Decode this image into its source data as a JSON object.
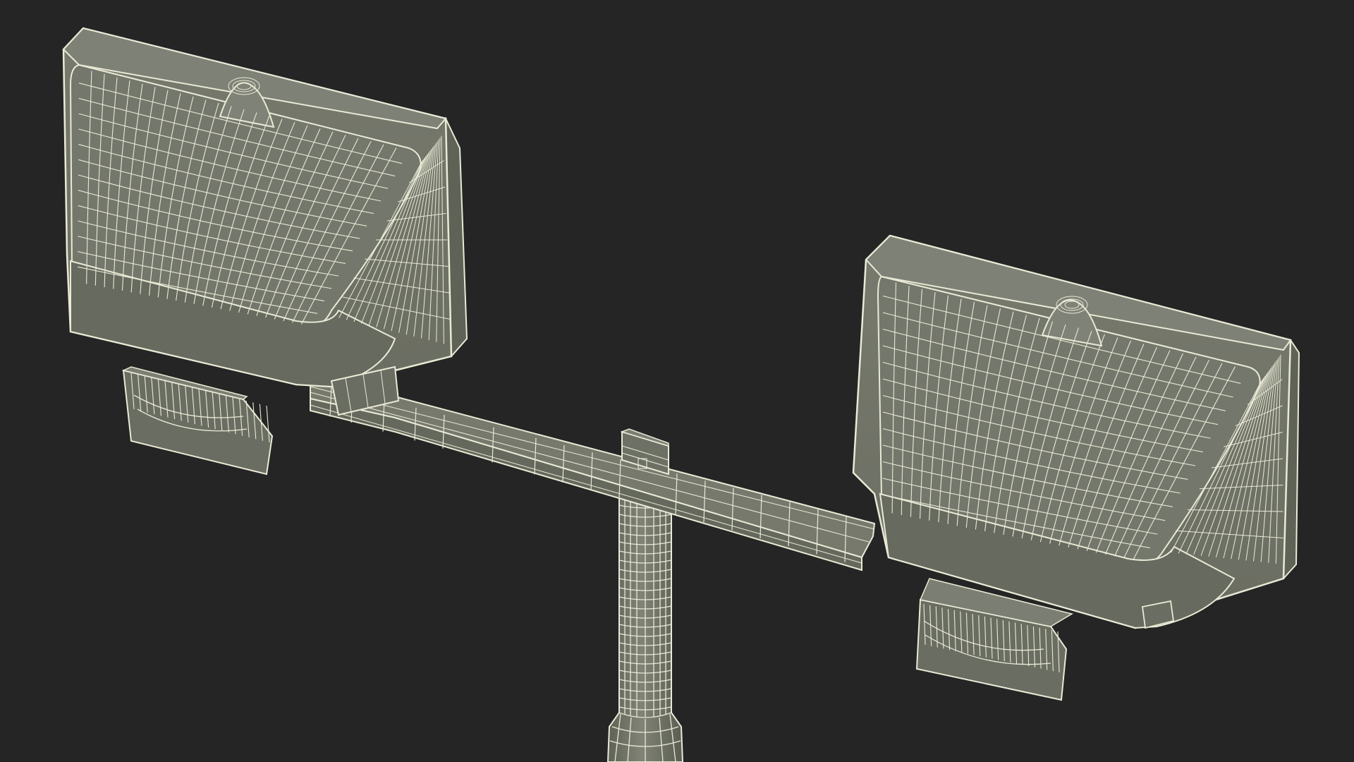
{
  "scene": {
    "subject": "twin-flood-light-pole-wireframe",
    "palette": {
      "background": "#252525",
      "surface": "#73766a",
      "surface_shade": "#5f6256",
      "surface_light": "#838678",
      "wire": "#e9ead6",
      "wire_dim": "#c9cab6"
    }
  }
}
